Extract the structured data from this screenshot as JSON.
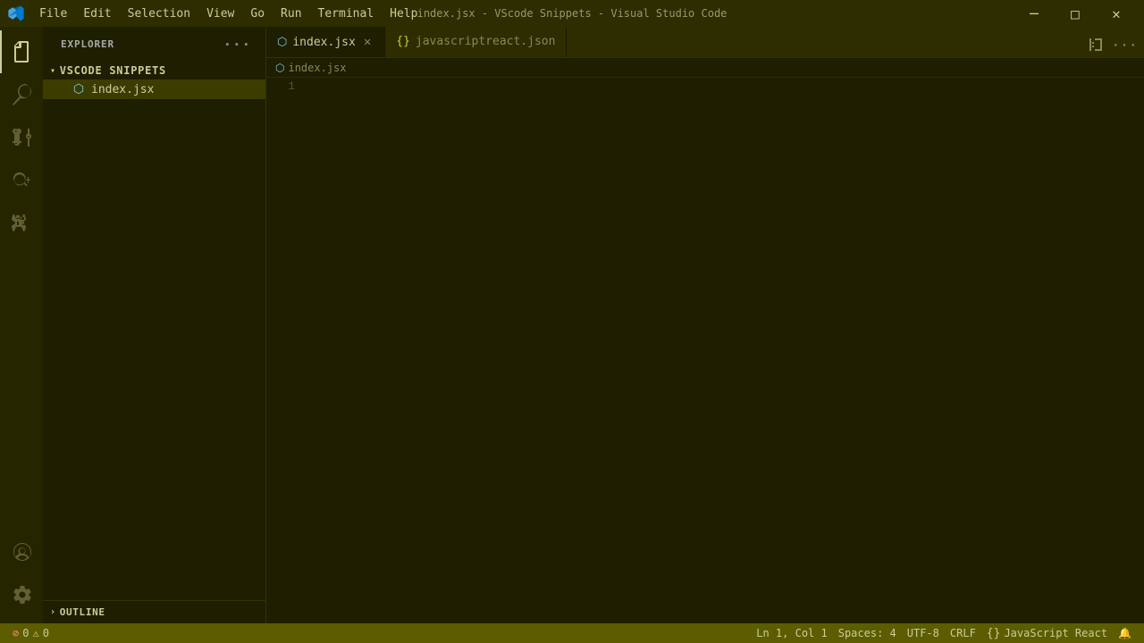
{
  "titleBar": {
    "title": "index.jsx - VScode Snippets - Visual Studio Code",
    "menuItems": [
      "File",
      "Edit",
      "Selection",
      "View",
      "Go",
      "Run",
      "Terminal",
      "Help"
    ],
    "windowControls": {
      "minimize": "─",
      "maximize": "□",
      "close": "✕"
    }
  },
  "activityBar": {
    "icons": [
      {
        "name": "explorer-icon",
        "symbol": "📄",
        "label": "Explorer",
        "active": true
      },
      {
        "name": "search-icon",
        "symbol": "🔍",
        "label": "Search",
        "active": false
      },
      {
        "name": "source-control-icon",
        "symbol": "⑂",
        "label": "Source Control",
        "active": false
      },
      {
        "name": "run-debug-icon",
        "symbol": "▷",
        "label": "Run and Debug",
        "active": false
      },
      {
        "name": "extensions-icon",
        "symbol": "⊞",
        "label": "Extensions",
        "active": false
      }
    ],
    "bottomIcons": [
      {
        "name": "accounts-icon",
        "symbol": "👤",
        "label": "Accounts",
        "active": false
      },
      {
        "name": "settings-icon",
        "symbol": "⚙",
        "label": "Settings",
        "active": false
      }
    ]
  },
  "sidebar": {
    "header": "Explorer",
    "moreOptionsLabel": "···",
    "folder": {
      "name": "VSCODE SNIPPETS",
      "expanded": true,
      "files": [
        {
          "name": "index.jsx",
          "active": true,
          "icon": "jsx"
        }
      ]
    },
    "outline": {
      "label": "OUTLINE",
      "expanded": false
    }
  },
  "tabs": [
    {
      "label": "index.jsx",
      "active": true,
      "icon": "jsx",
      "closeable": true
    },
    {
      "label": "javascriptreact.json",
      "active": false,
      "icon": "json",
      "closeable": false
    }
  ],
  "breadcrumb": {
    "filename": "index.jsx",
    "icon": "jsx"
  },
  "codeEditor": {
    "lines": [
      {
        "number": "1",
        "content": ""
      }
    ]
  },
  "statusBar": {
    "errors": "0",
    "warnings": "0",
    "position": "Ln 1, Col 1",
    "spaces": "Spaces: 4",
    "encoding": "UTF-8",
    "lineEnding": "CRLF",
    "language": "JavaScript React",
    "feedbackIcon": "🔔"
  }
}
